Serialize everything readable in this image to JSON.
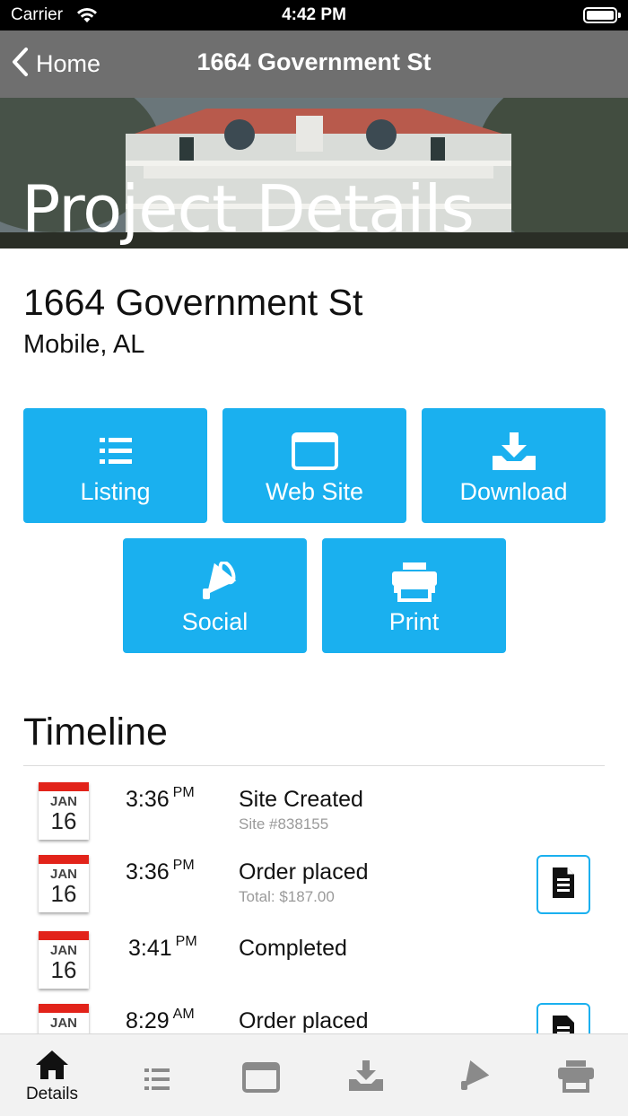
{
  "status_bar": {
    "carrier": "Carrier",
    "time": "4:42 PM"
  },
  "nav": {
    "back_label": "Home",
    "title": "1664 Government St"
  },
  "hero": {
    "title": "Project Details"
  },
  "address": {
    "street": "1664 Government St",
    "city": "Mobile, AL"
  },
  "actions": [
    {
      "label": "Listing",
      "icon": "list-icon"
    },
    {
      "label": "Web Site",
      "icon": "browser-window-icon"
    },
    {
      "label": "Download",
      "icon": "download-tray-icon"
    },
    {
      "label": "Social",
      "icon": "megaphone-icon"
    },
    {
      "label": "Print",
      "icon": "printer-icon"
    }
  ],
  "timeline": {
    "heading": "Timeline",
    "entries": [
      {
        "month": "JAN",
        "day": "16",
        "time": "3:36",
        "ampm": "PM",
        "event": "Site Created",
        "detail": "Site #838155",
        "has_doc": false
      },
      {
        "month": "JAN",
        "day": "16",
        "time": "3:36",
        "ampm": "PM",
        "event": "Order placed",
        "detail": "Total: $187.00",
        "has_doc": true
      },
      {
        "month": "JAN",
        "day": "16",
        "time": "3:41",
        "ampm": "PM",
        "event": "Completed",
        "detail": "",
        "has_doc": false
      },
      {
        "month": "JAN",
        "day": "",
        "time": "8:29",
        "ampm": "AM",
        "event": "Order placed",
        "detail": "",
        "has_doc": true
      }
    ]
  },
  "tab_bar": {
    "tabs": [
      {
        "label": "Details",
        "icon": "home-icon",
        "active": true
      },
      {
        "label": "",
        "icon": "list-icon",
        "active": false
      },
      {
        "label": "",
        "icon": "browser-window-icon",
        "active": false
      },
      {
        "label": "",
        "icon": "download-tray-icon",
        "active": false
      },
      {
        "label": "",
        "icon": "megaphone-icon",
        "active": false
      },
      {
        "label": "",
        "icon": "printer-icon",
        "active": false
      }
    ]
  },
  "colors": {
    "accent": "#1ab0ef",
    "nav_bar": "#6f6f6f",
    "calendar_red": "#e2231a",
    "tab_inactive": "#8a8a8a"
  }
}
